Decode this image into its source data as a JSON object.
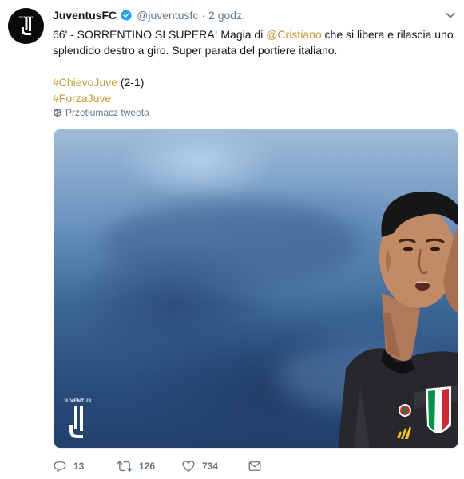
{
  "tweet": {
    "display_name": "JuventusFC",
    "handle": "@juventusfc",
    "separator": "·",
    "time": "2 godz.",
    "text_part1": "66' - SORRENTINO SI SUPERA! Magia di ",
    "mention": "@Cristiano",
    "text_part2": " che si libera e rilascia uno splendido destro a giro. Super parata del portiere italiano.",
    "hashtag1": "#ChievoJuve",
    "hashtag1_suffix": " (2-1)",
    "hashtag2": "#ForzaJuve",
    "translate_label": "Przetłumacz tweeta",
    "media_logo_word": "JUVENTUS",
    "avatar_text": "JUVENTUS"
  },
  "actions": {
    "reply_count": "13",
    "retweet_count": "126",
    "like_count": "734"
  },
  "colors": {
    "link": "#c49b3a",
    "verified": "#1da1f2",
    "muted": "#657786"
  },
  "icons": [
    "avatar-juventus-logo",
    "verified-badge-icon",
    "caret-down-icon",
    "globe-icon",
    "reply-icon",
    "retweet-icon",
    "heart-icon",
    "envelope-icon"
  ]
}
